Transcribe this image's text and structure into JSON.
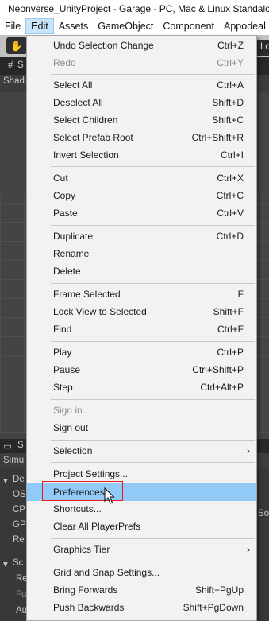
{
  "window": {
    "title": "Neonverse_UnityProject - Garage - PC, Mac & Linux Standalone"
  },
  "menubar": [
    "File",
    "Edit",
    "Assets",
    "GameObject",
    "Component",
    "Appodeal"
  ],
  "background": {
    "scene_tab": "S",
    "shading": "Shad",
    "panel_tab": "S",
    "panel_sub": "Simu",
    "labels": [
      "De",
      "OS",
      "CP",
      "GP",
      "Re",
      "Sc",
      "Re",
      "Fu",
      "Au"
    ],
    "right_glimpse": "Lo",
    "right_glimpse2": "So"
  },
  "edit_menu": {
    "items": [
      {
        "label": "Undo Selection Change",
        "shortcut": "Ctrl+Z"
      },
      {
        "label": "Redo",
        "shortcut": "Ctrl+Y",
        "disabled": true
      },
      {
        "label": "Select All",
        "shortcut": "Ctrl+A"
      },
      {
        "label": "Deselect All",
        "shortcut": "Shift+D"
      },
      {
        "label": "Select Children",
        "shortcut": "Shift+C"
      },
      {
        "label": "Select Prefab Root",
        "shortcut": "Ctrl+Shift+R"
      },
      {
        "label": "Invert Selection",
        "shortcut": "Ctrl+I"
      },
      {
        "label": "Cut",
        "shortcut": "Ctrl+X"
      },
      {
        "label": "Copy",
        "shortcut": "Ctrl+C"
      },
      {
        "label": "Paste",
        "shortcut": "Ctrl+V"
      },
      {
        "label": "Duplicate",
        "shortcut": "Ctrl+D"
      },
      {
        "label": "Rename",
        "shortcut": ""
      },
      {
        "label": "Delete",
        "shortcut": ""
      },
      {
        "label": "Frame Selected",
        "shortcut": "F"
      },
      {
        "label": "Lock View to Selected",
        "shortcut": "Shift+F"
      },
      {
        "label": "Find",
        "shortcut": "Ctrl+F"
      },
      {
        "label": "Play",
        "shortcut": "Ctrl+P"
      },
      {
        "label": "Pause",
        "shortcut": "Ctrl+Shift+P"
      },
      {
        "label": "Step",
        "shortcut": "Ctrl+Alt+P"
      },
      {
        "label": "Sign in...",
        "shortcut": "",
        "disabled": true
      },
      {
        "label": "Sign out",
        "shortcut": ""
      },
      {
        "label": "Selection",
        "shortcut": "",
        "submenu": true
      },
      {
        "label": "Project Settings...",
        "shortcut": ""
      },
      {
        "label": "Preferences...",
        "shortcut": "",
        "highlighted": true
      },
      {
        "label": "Shortcuts...",
        "shortcut": ""
      },
      {
        "label": "Clear All PlayerPrefs",
        "shortcut": ""
      },
      {
        "label": "Graphics Tier",
        "shortcut": "",
        "submenu": true
      },
      {
        "label": "Grid and Snap Settings...",
        "shortcut": ""
      },
      {
        "label": "Bring Forwards",
        "shortcut": "Shift+PgUp"
      },
      {
        "label": "Push Backwards",
        "shortcut": "Shift+PgDown"
      }
    ]
  },
  "colors": {
    "highlight": "#91c9f7",
    "annotation_box": "#e81a1a",
    "menu_bg": "#f2f2f2"
  }
}
